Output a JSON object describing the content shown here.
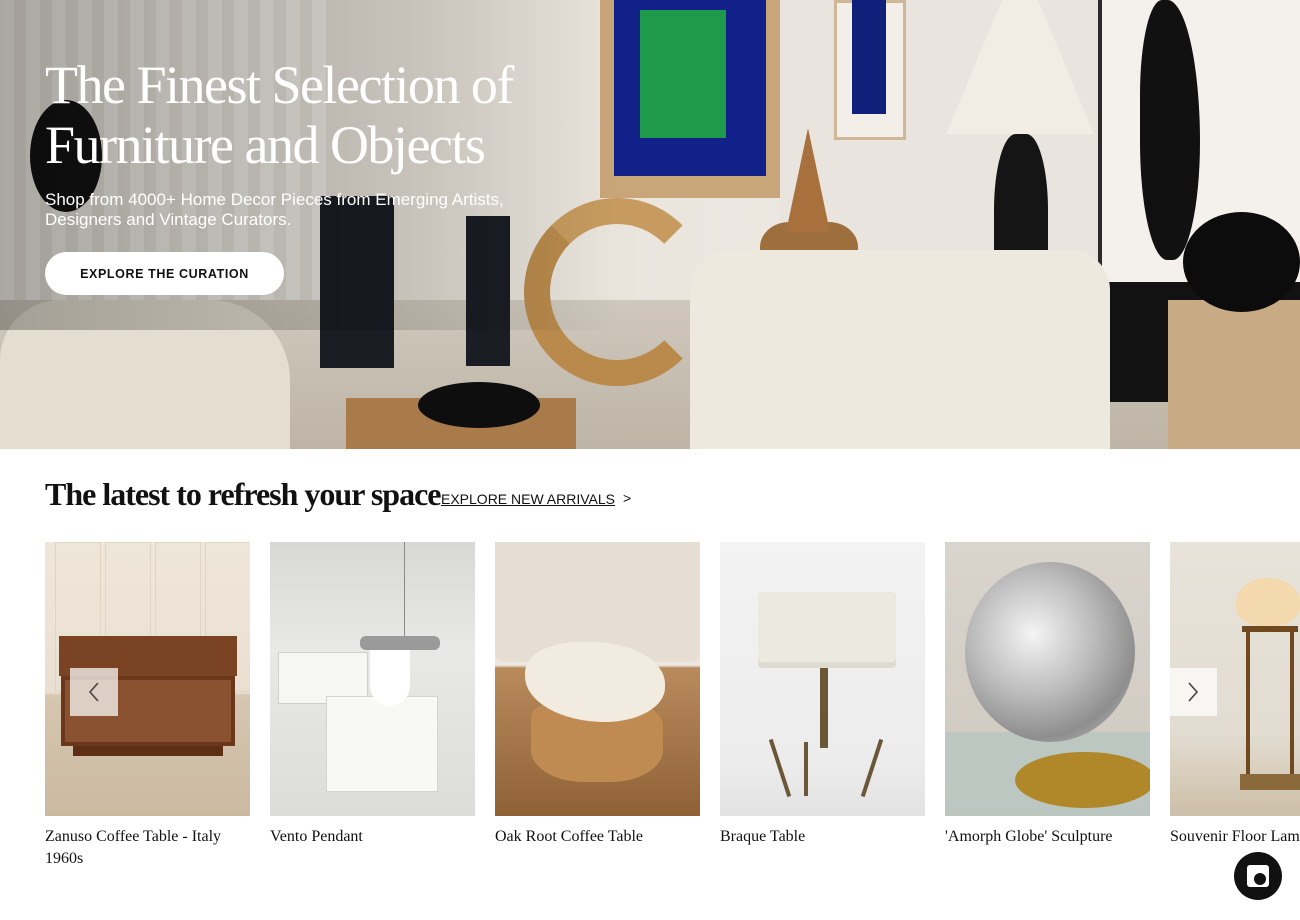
{
  "hero": {
    "title": "The Finest Selection of Furniture and Objects",
    "subtitle": "Shop from 4000+ Home Decor Pieces from Emerging Artists, Designers and Vintage Curators.",
    "cta_label": "EXPLORE THE CURATION",
    "image_subject": "curated living room interior"
  },
  "new_arrivals": {
    "heading": "The latest to refresh your space",
    "link_label": "EXPLORE NEW ARRIVALS",
    "link_chevron": ">",
    "products": [
      {
        "title": "Zanuso Coffee Table - Italy 1960s"
      },
      {
        "title": "Vento Pendant"
      },
      {
        "title": "Oak Root Coffee Table"
      },
      {
        "title": "Braque Table"
      },
      {
        "title": "'Amorph Globe' Sculpture"
      },
      {
        "title": "Souvenir Floor Lamp"
      }
    ]
  },
  "icons": {
    "prev": "chevron-left-icon",
    "next": "chevron-right-icon",
    "chat": "chat-icon"
  },
  "colors": {
    "text": "#111111",
    "button_bg": "#ffffff",
    "chat_bg": "#111111"
  }
}
